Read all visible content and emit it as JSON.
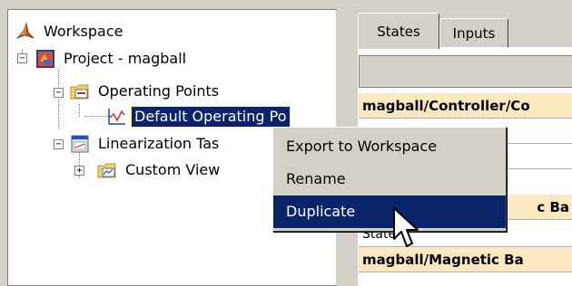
{
  "tree": {
    "workspace": "Workspace",
    "project": "Project - magball",
    "operating_points": "Operating Points",
    "default_operating_point": "Default Operating Po",
    "linearization_task": "Linearization Tas",
    "custom_views": "Custom View"
  },
  "tabs": {
    "states": "States",
    "inputs": "Inputs"
  },
  "table": {
    "rows": [
      "magball/Controller/Co",
      "",
      "",
      "c Ba",
      "State",
      "magball/Magnetic Ba"
    ]
  },
  "context_menu": {
    "items": [
      "Export to Workspace",
      "Rename",
      "Duplicate"
    ],
    "highlighted_item": "Duplicate"
  },
  "colors": {
    "selection": "#0a246a",
    "group_row": "#fce8c0",
    "window_bg": "#d4d0c8"
  },
  "icons": [
    "workspace-icon",
    "project-icon",
    "folder-icon",
    "operating-point-icon",
    "linearization-task-icon",
    "custom-view-folder-icon",
    "arrow-cursor-icon"
  ]
}
